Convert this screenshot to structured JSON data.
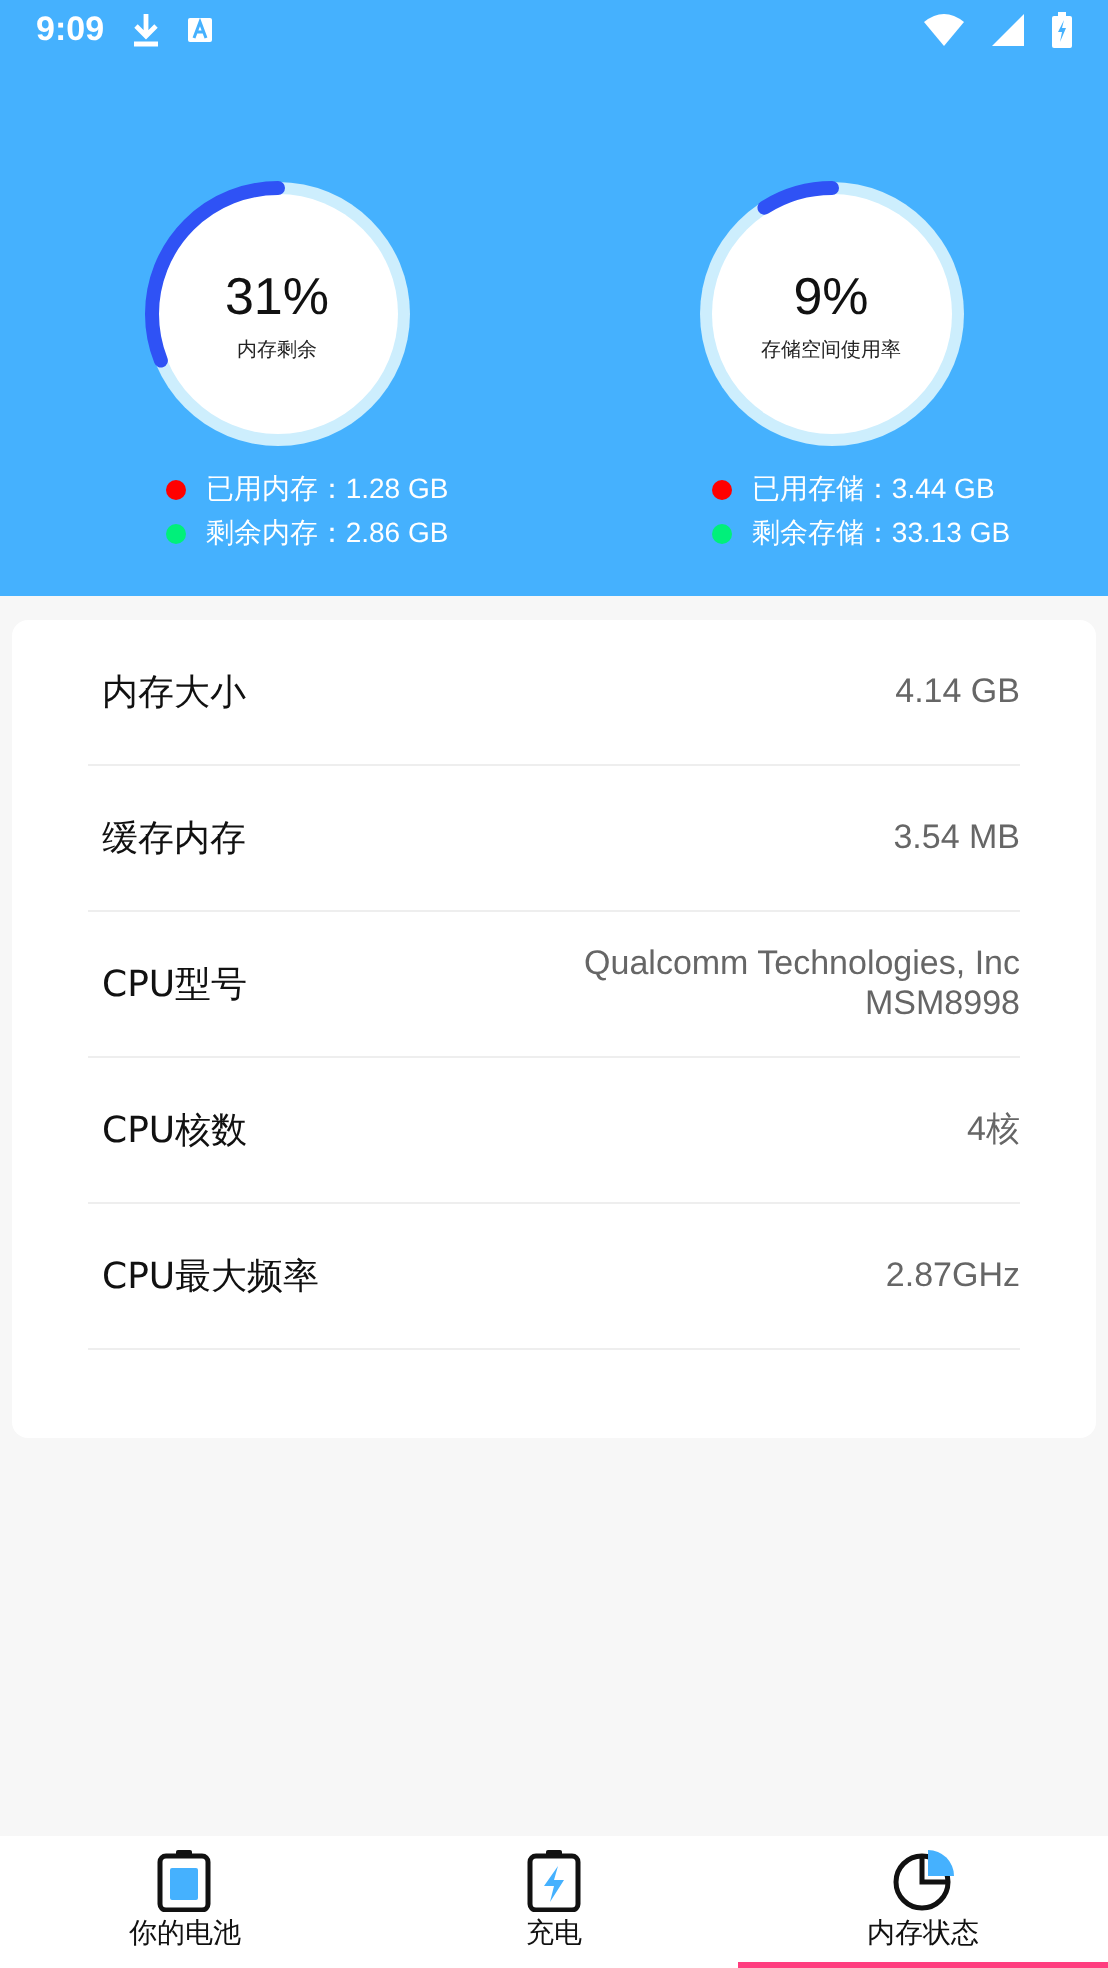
{
  "status_bar": {
    "time": "9:09"
  },
  "gauges": [
    {
      "value": "31%",
      "caption": "内存剩余",
      "level": 0.31,
      "legend": [
        {
          "text": "已用内存：1.28 GB",
          "color": "#ff0000"
        },
        {
          "text": "剩余内存：2.86 GB",
          "color": "#00f07a"
        }
      ]
    },
    {
      "value": "9%",
      "caption": "存储空间使用率",
      "level": 0.09,
      "legend": [
        {
          "text": "已用存储：3.44 GB",
          "color": "#ff0000"
        },
        {
          "text": "剩余存储：33.13 GB",
          "color": "#00f07a"
        }
      ]
    }
  ],
  "details": [
    {
      "label": "内存大小",
      "value": [
        "4.14 GB"
      ]
    },
    {
      "label": "缓存内存",
      "value": [
        "3.54 MB"
      ]
    },
    {
      "label": "CPU型号",
      "value": [
        "Qualcomm Technologies, Inc",
        "MSM8998"
      ]
    },
    {
      "label": "CPU核数",
      "value": [
        "4核"
      ]
    },
    {
      "label": "CPU最大频率",
      "value": [
        "2.87GHz"
      ]
    }
  ],
  "tabs": [
    {
      "label": "你的电池",
      "kind": "battery",
      "selected": false
    },
    {
      "label": "充电",
      "kind": "charging",
      "selected": false
    },
    {
      "label": "内存状态",
      "kind": "pie",
      "selected": true
    }
  ]
}
